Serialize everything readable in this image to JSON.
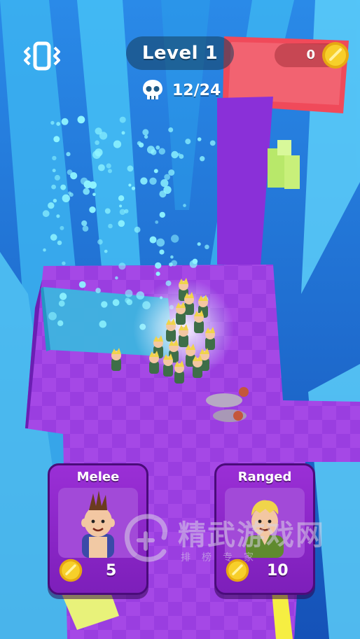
{
  "hud": {
    "level_label": "Level 1",
    "coins": "0",
    "kills": "12/24",
    "icons": {
      "vibration": "vibration-icon",
      "coin": "coin-icon",
      "skull": "skull-icon"
    }
  },
  "cards": [
    {
      "title": "Melee",
      "price": "5",
      "portrait": "punk-fighter-portrait"
    },
    {
      "title": "Ranged",
      "price": "10",
      "portrait": "blond-archer-portrait"
    }
  ],
  "watermark": {
    "main": "精武游戏网",
    "sub": "排榜专家"
  },
  "colors": {
    "floor": "#9b3fe0",
    "sky": "#1f6fd6",
    "water": "#39b9e0",
    "coin": "#f5c81e",
    "card": "#8a27c8"
  }
}
